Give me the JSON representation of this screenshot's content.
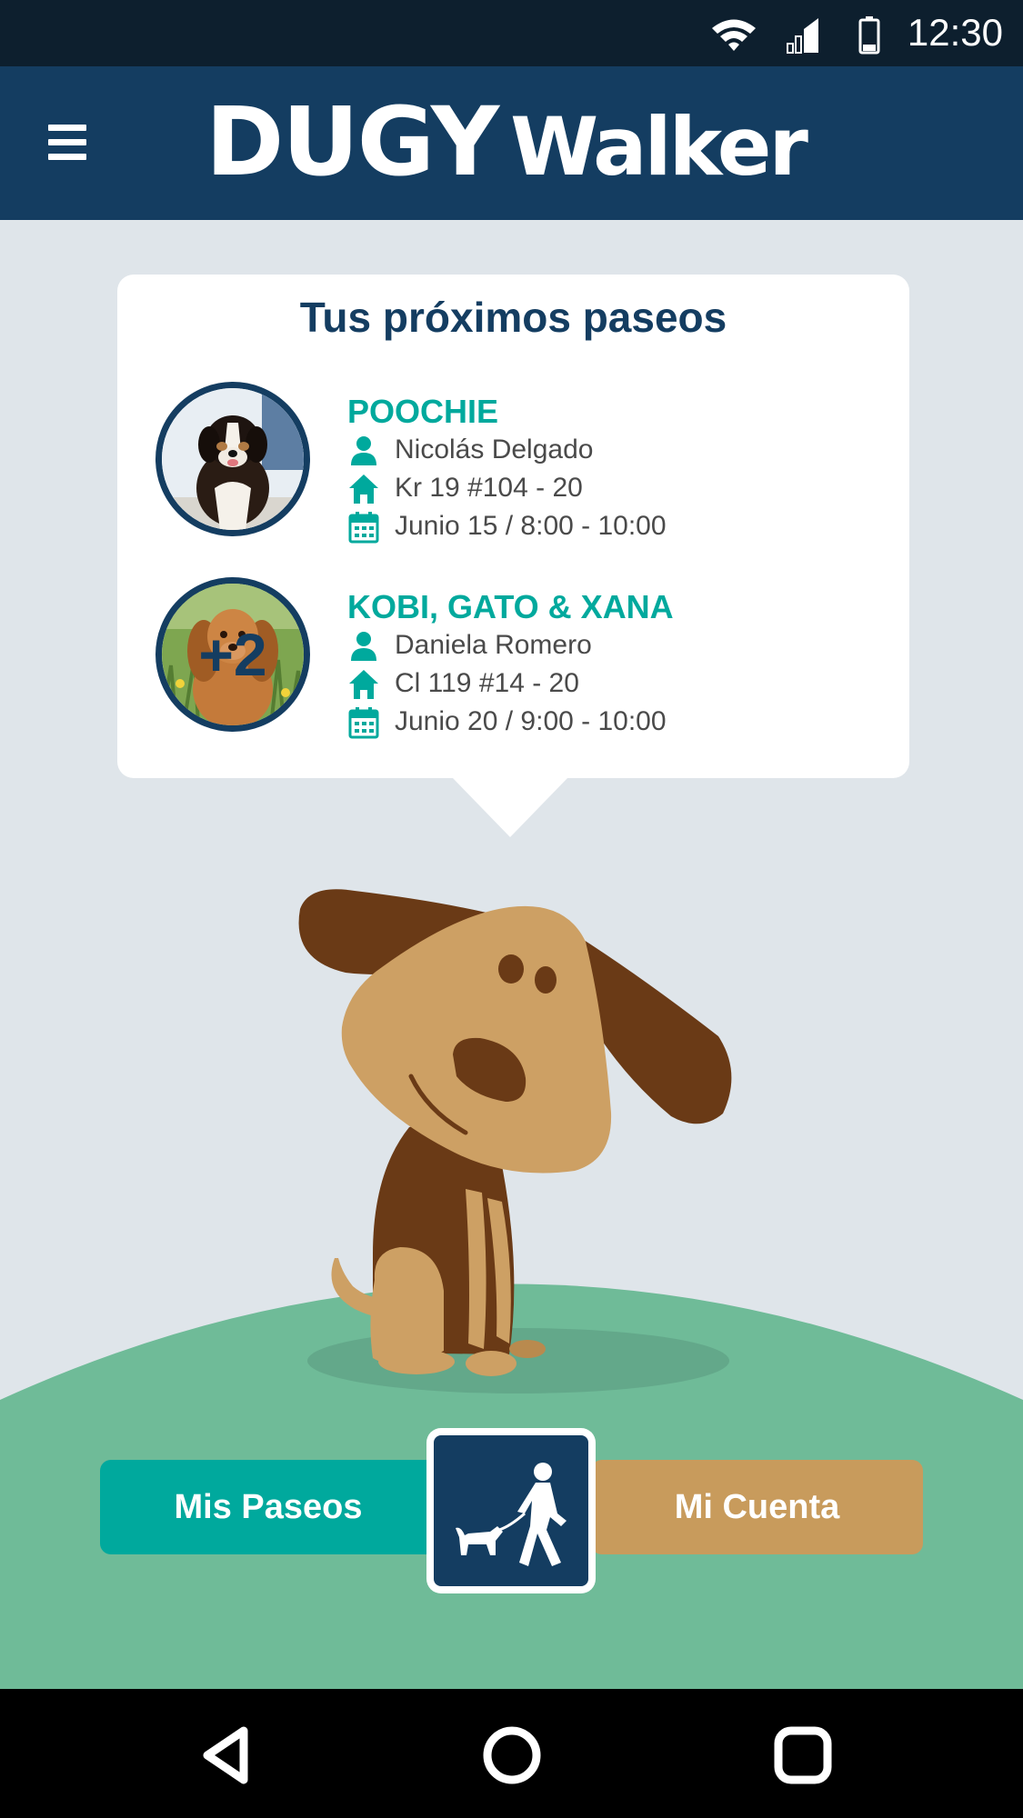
{
  "status_bar": {
    "time": "12:30",
    "icons": [
      "wifi-icon",
      "cellular-signal-icon",
      "battery-icon"
    ]
  },
  "app_bar": {
    "menu_icon": "hamburger-menu-icon",
    "logo_primary": "DUGY",
    "logo_secondary": "Walker"
  },
  "upcoming": {
    "title": "Tus próximos paseos",
    "walks": [
      {
        "pet_name": "POOCHIE",
        "owner": "Nicolás Delgado",
        "address": "Kr 19 #104 - 20",
        "schedule": "Junio 15 / 8:00 - 10:00",
        "avatar_overlay": ""
      },
      {
        "pet_name": "KOBI, GATO & XANA",
        "owner": "Daniela Romero",
        "address": "Cl 119 #14 - 20",
        "schedule": "Junio 20 / 9:00 - 10:00",
        "avatar_overlay": "+2"
      }
    ]
  },
  "actions": {
    "my_walks_label": "Mis Paseos",
    "my_account_label": "Mi Cuenta",
    "center_icon": "dog-walker-icon"
  },
  "nav_bar": {
    "icons": [
      "back-icon",
      "home-icon",
      "recents-icon"
    ]
  },
  "colors": {
    "app_bar": "#143d61",
    "status_bar": "#0d1f2e",
    "background": "#dfe5ea",
    "accent_teal": "#00a99d",
    "accent_tan": "#c89b5c",
    "grass": "#6fbb98",
    "dog_dark": "#6a3a16",
    "dog_light": "#cda064"
  }
}
